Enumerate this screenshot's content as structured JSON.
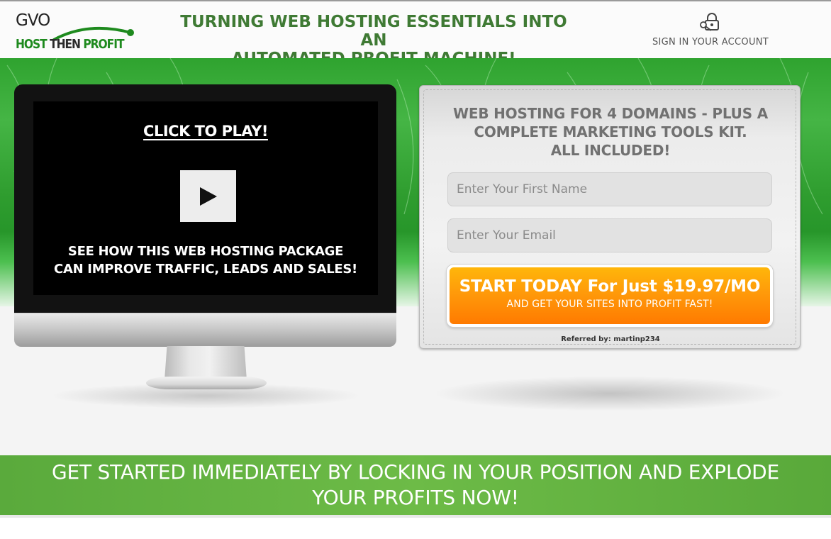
{
  "header": {
    "logo": {
      "top_text": "GVO",
      "brand_left": "HOST ",
      "brand_mid": "THEN ",
      "brand_right": "PROFIT"
    },
    "headline_line1": "TURNING WEB HOSTING ESSENTIALS INTO AN",
    "headline_line2": "AUTOMATED PROFIT MACHINE!",
    "signin_label": "SIGN IN YOUR ACCOUNT"
  },
  "video": {
    "click_to_play": "CLICK TO PLAY!",
    "caption_line1": "SEE HOW THIS WEB HOSTING PACKAGE",
    "caption_line2": "CAN IMPROVE TRAFFIC, LEADS AND SALES!"
  },
  "form": {
    "title_line1": "WEB HOSTING FOR 4 DOMAINS - PLUS A",
    "title_line2": "COMPLETE MARKETING TOOLS KIT.",
    "title_line3": "ALL INCLUDED!",
    "first_name_placeholder": "Enter Your First Name",
    "email_placeholder": "Enter Your Email",
    "cta_main": "START TODAY For Just $19.97/MO",
    "cta_sub": "AND GET YOUR SITES INTO PROFIT FAST!",
    "referred_by": "Referred by: martinp234"
  },
  "banner": {
    "line1": "GET STARTED IMMEDIATELY BY LOCKING IN YOUR POSITION AND EXPLODE",
    "line2": "YOUR PROFITS NOW!"
  },
  "colors": {
    "brand_green": "#3f7a34",
    "cta_orange": "#ff8c00",
    "banner_green": "#6dbb47"
  },
  "icons": {
    "signin": "key-lock-icon",
    "play": "play-icon",
    "logo": "globe-icon"
  }
}
